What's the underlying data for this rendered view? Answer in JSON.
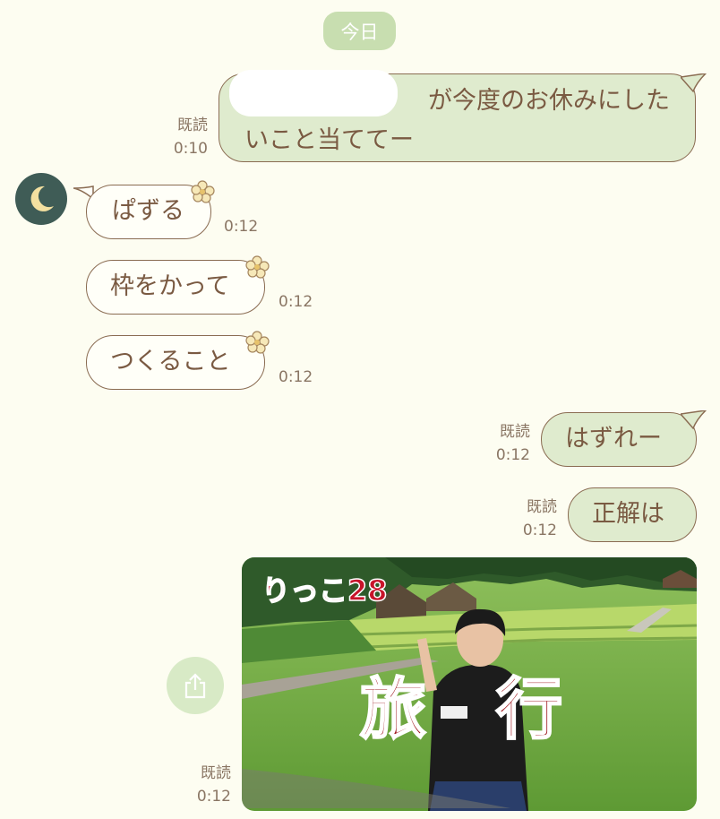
{
  "date_label": "今日",
  "messages": [
    {
      "side": "out",
      "lines": [
        "が今度のお休みにした",
        "いこと当ててー"
      ],
      "read": "既読",
      "time": "0:10"
    },
    {
      "side": "in",
      "text": "ぱずる",
      "time": "0:12"
    },
    {
      "side": "in",
      "text": "枠をかって",
      "time": "0:12"
    },
    {
      "side": "in",
      "text": "つくること",
      "time": "0:12"
    },
    {
      "side": "out",
      "text": "はずれー",
      "read": "既読",
      "time": "0:12"
    },
    {
      "side": "out",
      "text": "正解は",
      "read": "既読",
      "time": "0:12"
    },
    {
      "side": "out",
      "type": "image",
      "overlay_top": "りっこ28",
      "overlay_big": "旅　行",
      "read": "既読",
      "time": "0:12"
    }
  ],
  "icons": {
    "avatar": "moon-icon",
    "sticker": "flower-icon",
    "share": "share-icon"
  },
  "colors": {
    "background": "#fdfdf1",
    "out_bubble": "#dfebce",
    "in_bubble": "#fffff8",
    "border": "#8a6c52",
    "date_pill": "#c8deb0"
  }
}
